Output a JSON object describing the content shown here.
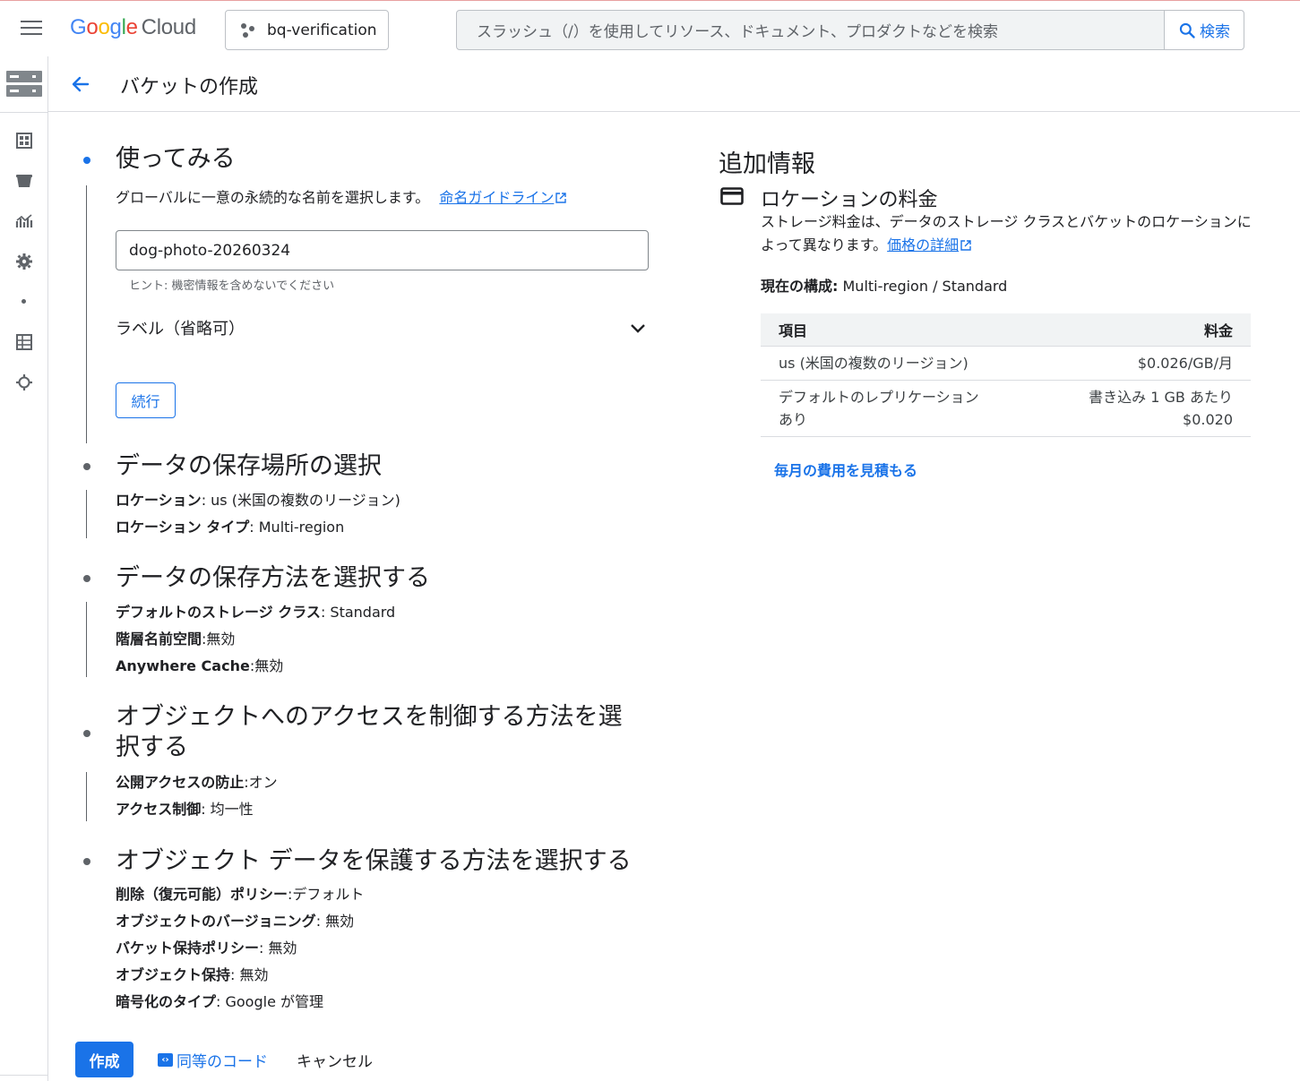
{
  "header": {
    "logo_google": "Google",
    "logo_cloud": "Cloud",
    "project": "bq-verification",
    "search_placeholder": "スラッシュ（/）を使用してリソース、ドキュメント、プロダクトなどを検索",
    "search_button": "検索"
  },
  "page": {
    "title": "バケットの作成"
  },
  "steps": {
    "get_started": {
      "title": "使ってみる",
      "desc": "グローバルに一意の永続的な名前を選択します。",
      "naming_link": "命名ガイドライン",
      "name_value": "dog-photo-20260324",
      "hint": "ヒント: 機密情報を含めないでください",
      "labels": "ラベル（省略可）",
      "continue": "続行"
    },
    "location": {
      "title": "データの保存場所の選択",
      "items": [
        {
          "key": "ロケーション",
          "value": ": us (米国の複数のリージョン)"
        },
        {
          "key": "ロケーション タイプ",
          "value": ": Multi-region"
        }
      ]
    },
    "storage": {
      "title": "データの保存方法を選択する",
      "items": [
        {
          "key": "デフォルトのストレージ クラス",
          "value": ": Standard"
        },
        {
          "key": "階層名前空間",
          "value": ":無効"
        },
        {
          "key": "Anywhere Cache",
          "value": ":無効"
        }
      ]
    },
    "access": {
      "title_line1": "オブジェクトへのアクセスを制御する方法を選",
      "title_line2": "択する",
      "items": [
        {
          "key": "公開アクセスの防止",
          "value": ":オン"
        },
        {
          "key": "アクセス制御",
          "value": ": 均一性"
        }
      ]
    },
    "protection": {
      "title": "オブジェクト データを保護する方法を選択する",
      "items": [
        {
          "key": "削除（復元可能）ポリシー",
          "value": ":デフォルト"
        },
        {
          "key": "オブジェクトのバージョニング",
          "value": ": 無効"
        },
        {
          "key": "バケット保持ポリシー",
          "value": ": 無効"
        },
        {
          "key": "オブジェクト保持",
          "value": ": 無効"
        },
        {
          "key": "暗号化のタイプ",
          "value": ": Google が管理"
        }
      ]
    }
  },
  "actions": {
    "create": "作成",
    "code": "同等のコード",
    "cancel": "キャンセル"
  },
  "info": {
    "title": "追加情報",
    "price_title": "ロケーションの料金",
    "price_desc": "ストレージ料金は、データのストレージ クラスとバケットのロケーションによって異なります。",
    "price_link": "価格の詳細",
    "current_label": "現在の構成:",
    "current_value": " Multi-region / Standard",
    "table_headers": [
      "項目",
      "料金"
    ],
    "table_rows": [
      {
        "item": "us (米国の複数のリージョン)",
        "price": "$0.026/GB/月"
      },
      {
        "item_line1": "デフォルトのレプリケーション",
        "item_line2": "あり",
        "price_line1": "書き込み 1 GB あたり",
        "price_line2": "$0.020"
      }
    ],
    "estimate_link": "毎月の費用を見積もる"
  },
  "colors": {
    "accent": "#1a73e8",
    "text": "#202124",
    "muted": "#5f6368"
  }
}
